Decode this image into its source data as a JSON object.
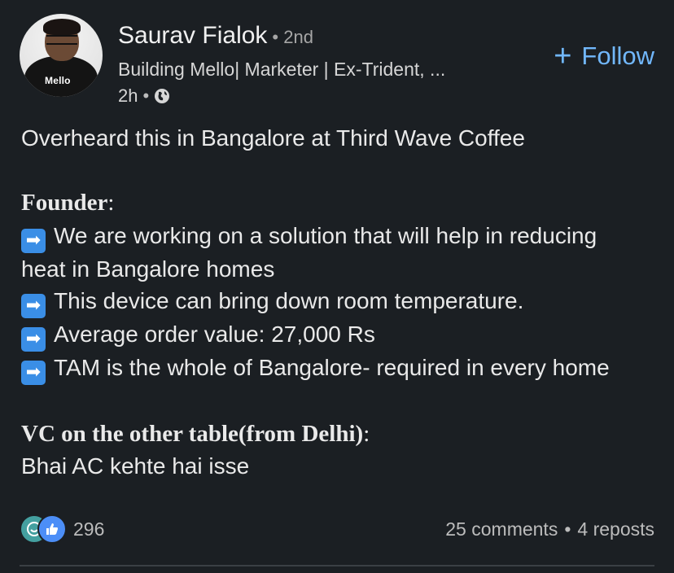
{
  "author": {
    "name": "Saurav Fialok",
    "degree": "• 2nd",
    "headline": "Building Mello| Marketer | Ex-Trident, ...",
    "time": "2h",
    "separator": "•",
    "avatar_logo": "Mello"
  },
  "follow": {
    "icon": "+",
    "label": "Follow"
  },
  "post": {
    "line1": "Overheard this in Bangalore at Third Wave Coffee",
    "founder_label": "Founder",
    "founder_colon": ":",
    "arrow_glyph": "➡",
    "bullets": [
      "We are working on a solution that will help in reducing",
      "heat in Bangalore homes",
      "This device can bring down room temperature.",
      "Average order value: 27,000 Rs",
      "TAM is the whole of Bangalore- required in every home"
    ],
    "vc_label": "VC on the other table(from Delhi)",
    "vc_colon": ":",
    "vc_reply": "Bhai AC kehte hai isse"
  },
  "social": {
    "reaction_count": "296",
    "comments": "25 comments",
    "separator": "•",
    "reposts": "4 reposts"
  },
  "colors": {
    "background": "#1b1f23",
    "accent": "#71b7fb",
    "arrow_bg": "#3a8ee6",
    "like": "#4c8ef7",
    "celebrate": "#44a0a0"
  }
}
